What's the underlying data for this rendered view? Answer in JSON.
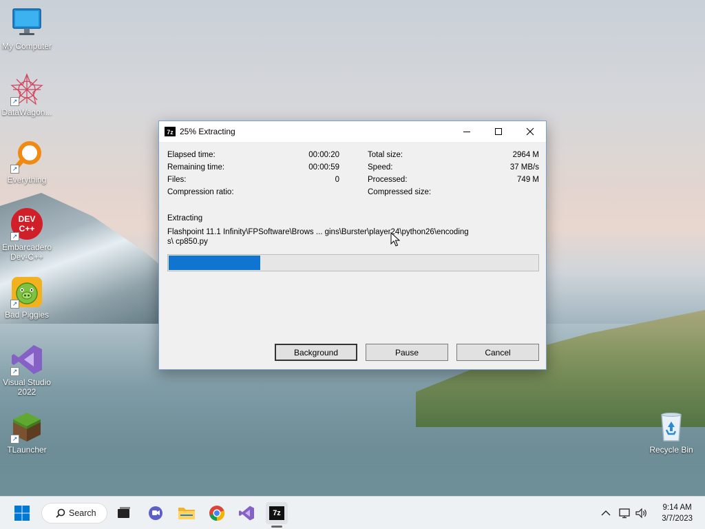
{
  "desktop": {
    "icons": [
      {
        "label": "My Computer",
        "icon": "monitor-icon"
      },
      {
        "label": "DataWagon...",
        "icon": "star-web-icon"
      },
      {
        "label": "Everything",
        "icon": "magnifier-icon"
      },
      {
        "label": "Embarcadero Dev-C++",
        "icon": "devcpp-icon",
        "badge": "DEV C++"
      },
      {
        "label": "Bad Piggies",
        "icon": "pig-icon"
      },
      {
        "label": "Visual Studio 2022",
        "icon": "visual-studio-icon"
      },
      {
        "label": "TLauncher",
        "icon": "grass-block-icon"
      },
      {
        "label": "Recycle Bin",
        "icon": "recycle-bin-icon"
      }
    ]
  },
  "window": {
    "app_icon_text": "7z",
    "title": "25% Extracting",
    "left_stats": [
      {
        "label": "Elapsed time:",
        "value": "00:00:20"
      },
      {
        "label": "Remaining time:",
        "value": "00:00:59"
      },
      {
        "label": "Files:",
        "value": "0"
      },
      {
        "label": "Compression ratio:",
        "value": ""
      }
    ],
    "right_stats": [
      {
        "label": "Total size:",
        "value": "2964 M"
      },
      {
        "label": "Speed:",
        "value": "37 MB/s"
      },
      {
        "label": "Processed:",
        "value": "749 M"
      },
      {
        "label": "Compressed size:",
        "value": ""
      }
    ],
    "section_label": "Extracting",
    "current_path": "Flashpoint 11.1 Infinity\\FPSoftware\\Brows ... gins\\Burster\\player24\\python26\\encodings\\ cp850.py",
    "progress_percent": 25,
    "buttons": {
      "background": "Background",
      "pause": "Pause",
      "cancel": "Cancel"
    }
  },
  "taskbar": {
    "search_label": "Search",
    "time": "9:14 AM",
    "date": "3/7/2023"
  },
  "colors": {
    "progress": "#0f75d1",
    "accent": "#0078d4"
  }
}
